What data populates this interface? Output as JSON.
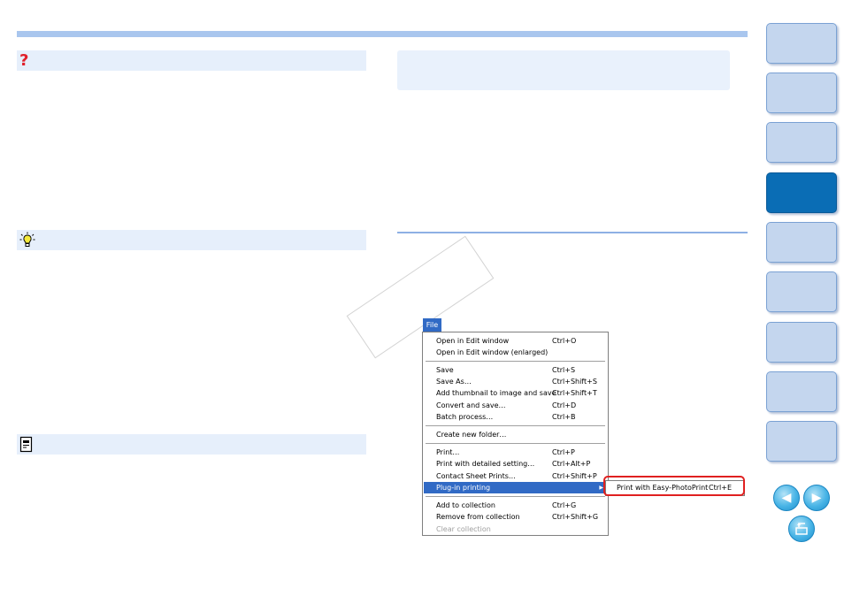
{
  "menu": {
    "bar_label": "File",
    "items": [
      {
        "label": "Open in Edit window",
        "shortcut": "Ctrl+O"
      },
      {
        "label": "Open in Edit window (enlarged)",
        "shortcut": ""
      },
      {
        "label": "Save",
        "shortcut": "Ctrl+S"
      },
      {
        "label": "Save As…",
        "shortcut": "Ctrl+Shift+S"
      },
      {
        "label": "Add thumbnail to image and save",
        "shortcut": "Ctrl+Shift+T"
      },
      {
        "label": "Convert and save…",
        "shortcut": "Ctrl+D"
      },
      {
        "label": "Batch process…",
        "shortcut": "Ctrl+B"
      },
      {
        "label": "Create new folder…",
        "shortcut": ""
      },
      {
        "label": "Print…",
        "shortcut": "Ctrl+P"
      },
      {
        "label": "Print with detailed setting…",
        "shortcut": "Ctrl+Alt+P"
      },
      {
        "label": "Contact Sheet Prints…",
        "shortcut": "Ctrl+Shift+P"
      },
      {
        "label": "Plug-in printing",
        "shortcut": ""
      },
      {
        "label": "Add to collection",
        "shortcut": "Ctrl+G"
      },
      {
        "label": "Remove from collection",
        "shortcut": "Ctrl+Shift+G"
      },
      {
        "label": "Clear collection",
        "shortcut": ""
      }
    ],
    "submenu": {
      "label": "Print with Easy-PhotoPrint",
      "shortcut": "Ctrl+E"
    }
  },
  "icons": {
    "question": "?",
    "tip": "lightbulb-icon",
    "memo": "memo-icon",
    "prev": "arrow-left-icon",
    "next": "arrow-right-icon",
    "back": "return-icon"
  },
  "colors": {
    "accent": "#a9c6ee",
    "strip": "#e6effb",
    "tab": "#c4d6ee",
    "tab_active": "#0a6db5",
    "highlight": "#316ac5",
    "frame": "#e02020"
  }
}
